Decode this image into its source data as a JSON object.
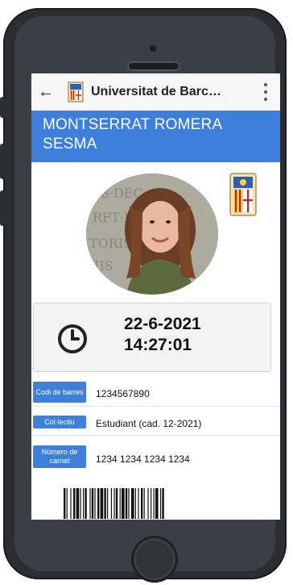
{
  "app": {
    "title": "Universitat de Barc…"
  },
  "card": {
    "name": "MONTSERRAT ROMERA SESMA",
    "date": "22-6-2021",
    "time": "14:27:01",
    "rows": [
      {
        "label": "Codi de barres",
        "value": "1234567890"
      },
      {
        "label": "Col·lectiu",
        "value": "Estudiant (cad. 12-2021)"
      },
      {
        "label": "Número de carnet",
        "value": "1234 1234 1234 1234"
      }
    ]
  },
  "icons": {
    "back": "arrow-left-icon",
    "menu": "more-vert-icon",
    "clock": "clock-icon",
    "logo": "university-crest-icon"
  },
  "colors": {
    "accent": "#3e7fdc",
    "phone": "#2b2f33",
    "card_bg": "#f3f3f3"
  }
}
